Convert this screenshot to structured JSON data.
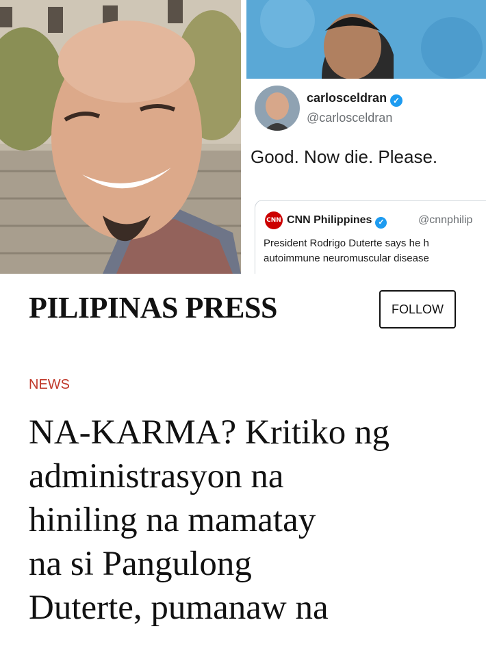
{
  "tweet": {
    "author_name": "carlosceldran",
    "author_handle": "@carlosceldran",
    "text": "Good. Now die. Please.",
    "quoted": {
      "logo_text": "CNN",
      "name": "CNN Philippines",
      "handle": "@cnnphilip",
      "line1": "President Rodrigo Duterte says he h",
      "line2": "autoimmune neuromuscular disease"
    }
  },
  "publisher": {
    "name": "PILIPINAS PRESS",
    "follow_label": "FOLLOW"
  },
  "article": {
    "category": "NEWS",
    "category_color": "#c0392b",
    "headline_lines": [
      "NA-KARMA? Kritiko ng",
      "administrasyon na",
      "hiniling na mamatay",
      "na si Pangulong",
      "Duterte, pumanaw na"
    ]
  },
  "icons": {
    "verified": "verified-checkmark-icon"
  }
}
